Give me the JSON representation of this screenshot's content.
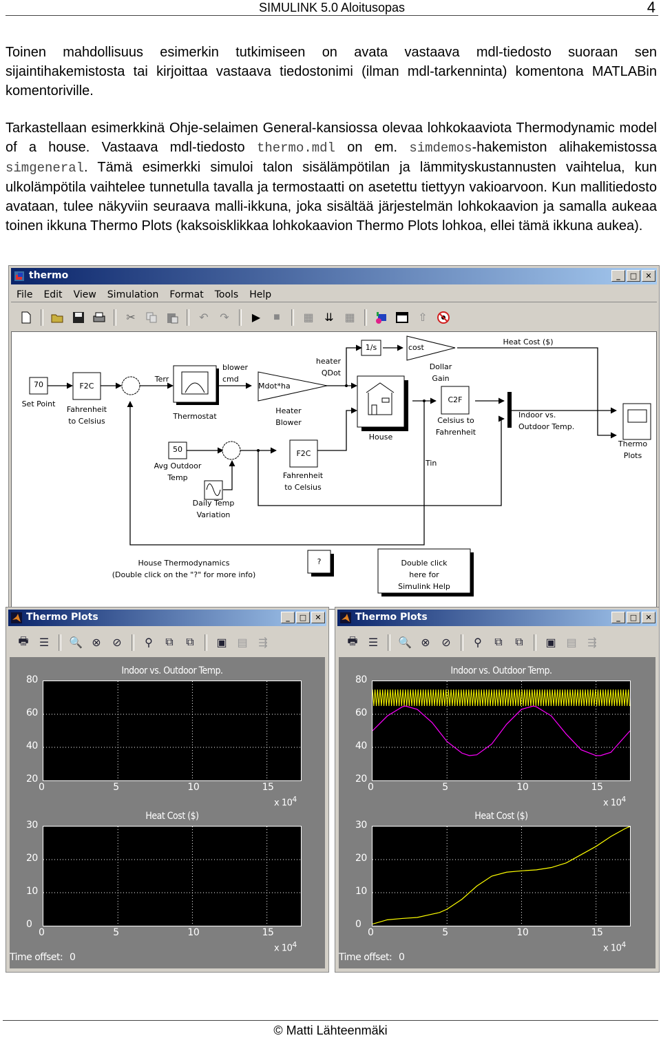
{
  "header": {
    "title": "SIMULINK 5.0 Aloitusopas",
    "page_number": "4"
  },
  "paragraphs": {
    "p1": "Toinen mahdollisuus esimerkin tutkimiseen on avata vastaava mdl-tiedosto suoraan sen sijaintihakemistosta tai kirjoittaa vastaava tiedostonimi (ilman mdl-tarkenninta) komentona MATLABin komentoriville.",
    "p2_a": "Tarkastellaan esimerkkinä Ohje-selaimen General-kansiossa olevaa lohkokaaviota Thermodynamic model of a house. Vastaava mdl-tiedosto ",
    "p2_code1": "thermo.mdl",
    "p2_b": " on em. ",
    "p2_code2": "simdemos",
    "p2_c": "-hakemiston alihakemistossa ",
    "p2_code3": "simgeneral",
    "p2_d": ". Tämä esimerkki simuloi talon sisälämpötilan ja lämmityskustannusten vaihtelua, kun ulkolämpötila vaihtelee tunnetulla tavalla ja termostaatti on asetettu tiettyyn vakioarvoon. Kun mallitiedosto avataan, tulee näkyviin seuraava malli-ikkuna, joka sisältää järjestelmän lohkokaavion ja samalla aukeaa toinen ikkuna Thermo Plots (kaksoisklikkaa lohkokaavion Thermo Plots lohkoa, ellei tämä ikkuna aukea)."
  },
  "model_window": {
    "title": "thermo",
    "menu": [
      "File",
      "Edit",
      "View",
      "Simulation",
      "Format",
      "Tools",
      "Help"
    ],
    "toolbar_icons": [
      "new-icon",
      "open-icon",
      "save-icon",
      "print-icon",
      "cut-icon",
      "copy-icon",
      "paste-icon",
      "undo-icon",
      "redo-icon",
      "play-icon",
      "stop-icon",
      "build-icon",
      "update-icon",
      "build-subsystem-icon",
      "library-browser-icon",
      "model-explorer-icon",
      "parent-icon",
      "debug-icon"
    ],
    "blocks": {
      "set_point_value": "70",
      "set_point_label": "Set Point",
      "f2c_1": "F2C",
      "f2c_1_label": "Fahrenheit\nto Celsius",
      "sum1_signs": "+−",
      "terr": "Terr",
      "thermostat_label": "Thermostat",
      "blower_cmd": "blower\ncmd",
      "gain_heater": "Mdot*ha",
      "heater_label": "Heater\nBlower",
      "heater_qdot": "heater\nQDot",
      "integrator": "1/s",
      "cost_gain": "cost",
      "dollar_gain_label": "Dollar\nGain",
      "heat_cost_signal": "Heat Cost ($)",
      "house_label": "House",
      "c2f": "C2F",
      "c2f_label": "Celsius to\nFahrenheit",
      "mux_label": "Indoor vs.\nOutdoor Temp.",
      "scope_label": "Thermo\nPlots",
      "avg_outdoor_value": "50",
      "avg_outdoor_label": "Avg Outdoor\nTemp",
      "sum2_signs": "++",
      "f2c_2": "F2C",
      "f2c_2_label": "Fahrenheit\nto Celsius",
      "daily_label": "Daily Temp\nVariation",
      "tin": "Tin",
      "annotation": "House Thermodynamics\n(Double click on the \"?\" for more info)",
      "info_button": "?",
      "help_button": "Double click\nhere for\nSimulink Help"
    }
  },
  "plot_windows": [
    {
      "title": "Thermo Plots",
      "state": "before simulation",
      "time_offset_label": "Time offset:",
      "time_offset_value": "0",
      "x_exponent": "x 10",
      "x_exponent_power": "4"
    },
    {
      "title": "Thermo Plots",
      "state": "after simulation",
      "time_offset_label": "Time offset:",
      "time_offset_value": "0",
      "x_exponent": "x 10",
      "x_exponent_power": "4"
    }
  ],
  "plot_toolbar_icons": [
    "print-icon",
    "properties-icon",
    "zoom-icon",
    "zoom-x-icon",
    "zoom-y-icon",
    "autoscale-icon",
    "save-axes-icon",
    "restore-axes-icon",
    "floating-scope-icon",
    "lock-icon",
    "signal-select-icon"
  ],
  "chart_data": [
    {
      "type": "line",
      "title": "Indoor vs. Outdoor Temp.",
      "panel": "left-top",
      "xlim": [
        0,
        17.28
      ],
      "ylim": [
        20,
        80
      ],
      "xticks": [
        0,
        5,
        10,
        15
      ],
      "yticks": [
        20,
        40,
        60,
        80
      ],
      "x_multiplier": "x 10^4",
      "grid": true,
      "series": []
    },
    {
      "type": "line",
      "title": "Heat Cost ($)",
      "panel": "left-bottom",
      "xlim": [
        0,
        17.28
      ],
      "ylim": [
        0,
        30
      ],
      "xticks": [
        0,
        5,
        10,
        15
      ],
      "yticks": [
        0,
        10,
        20,
        30
      ],
      "x_multiplier": "x 10^4",
      "grid": true,
      "series": []
    },
    {
      "type": "line",
      "title": "Indoor vs. Outdoor Temp.",
      "panel": "right-top",
      "xlim": [
        0,
        17.28
      ],
      "ylim": [
        20,
        80
      ],
      "xticks": [
        0,
        5,
        10,
        15
      ],
      "yticks": [
        20,
        40,
        60,
        80
      ],
      "x_multiplier": "x 10^4",
      "grid": true,
      "series": [
        {
          "name": "Indoor (thermostat sawtooth)",
          "color": "#ffff00",
          "band_min": 65,
          "band_max": 75
        },
        {
          "name": "Outdoor",
          "color": "#ff00ff",
          "x": [
            0,
            1,
            2,
            2.2,
            3,
            4,
            5,
            6,
            6.5,
            7,
            8,
            9,
            10,
            10.8,
            11,
            12,
            13,
            14,
            15,
            15.3,
            16,
            17.28
          ],
          "y": [
            50,
            59,
            64.5,
            65,
            63,
            55,
            43.5,
            36.5,
            35,
            35.5,
            42,
            54,
            63,
            65,
            64.5,
            59,
            48,
            38.5,
            35,
            35,
            37,
            50
          ]
        }
      ]
    },
    {
      "type": "line",
      "title": "Heat Cost ($)",
      "panel": "right-bottom",
      "xlim": [
        0,
        17.28
      ],
      "ylim": [
        0,
        30
      ],
      "xticks": [
        0,
        5,
        10,
        15
      ],
      "yticks": [
        0,
        10,
        20,
        30
      ],
      "x_multiplier": "x 10^4",
      "grid": true,
      "series": [
        {
          "name": "Heat Cost",
          "color": "#ffff00",
          "x": [
            0,
            1,
            2,
            3,
            4,
            4.5,
            5,
            6,
            7,
            8,
            9,
            10,
            11,
            12,
            13,
            14,
            15,
            16,
            17,
            17.28
          ],
          "y": [
            0.5,
            1.8,
            2.2,
            2.5,
            3.5,
            4,
            5,
            8,
            12,
            15,
            16.2,
            16.6,
            16.9,
            17.6,
            19,
            21.5,
            24,
            27,
            29.5,
            30
          ]
        }
      ]
    }
  ],
  "footer": {
    "copyright": "© Matti Lähteenmäki"
  }
}
